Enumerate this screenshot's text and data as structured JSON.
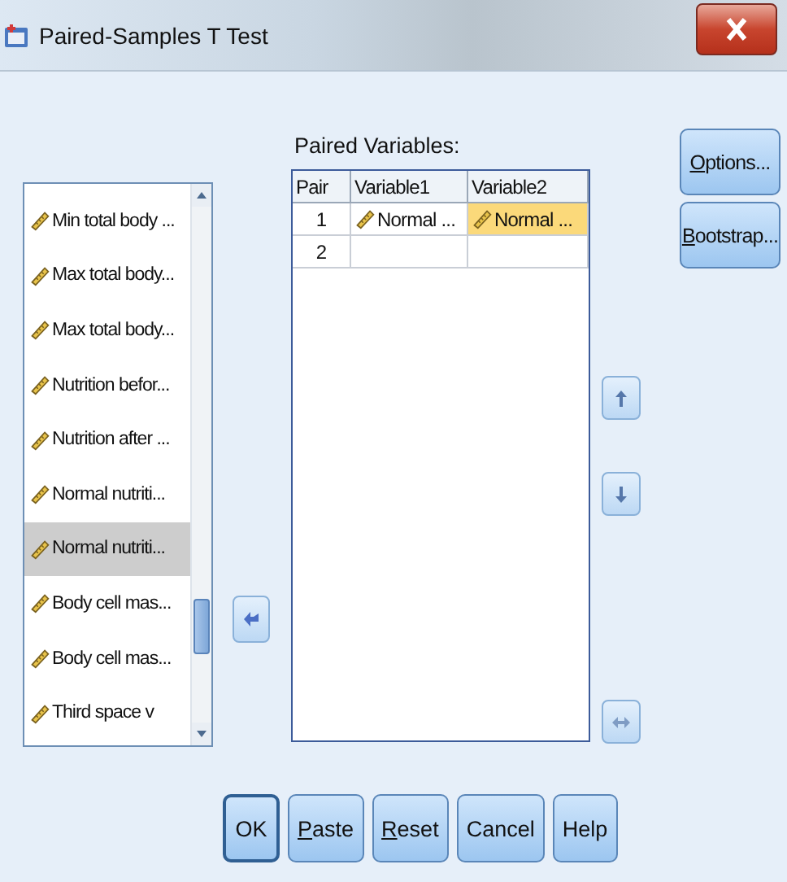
{
  "window": {
    "title": "Paired-Samples T Test"
  },
  "variables": [
    {
      "name": "Min total body ...",
      "selected": false
    },
    {
      "name": "Max total body...",
      "selected": false
    },
    {
      "name": "Max total body...",
      "selected": false
    },
    {
      "name": "Nutrition befor...",
      "selected": false
    },
    {
      "name": "Nutrition after ...",
      "selected": false
    },
    {
      "name": "Normal nutriti...",
      "selected": false
    },
    {
      "name": "Normal nutriti...",
      "selected": true
    },
    {
      "name": "Body cell mas...",
      "selected": false
    },
    {
      "name": "Body cell mas...",
      "selected": false
    },
    {
      "name": "Third space v",
      "selected": false
    }
  ],
  "paired_variables": {
    "label": "Paired Variables:",
    "columns": [
      "Pair",
      "Variable1",
      "Variable2"
    ],
    "rows": [
      {
        "pair": "1",
        "variable1": {
          "name": "Normal ...",
          "selected": false
        },
        "variable2": {
          "name": "Normal ...",
          "selected": true
        }
      },
      {
        "pair": "2"
      }
    ]
  },
  "side_buttons": [
    {
      "label": "Options...",
      "underline_first": true
    },
    {
      "label": "Bootstrap...",
      "underline_first": true
    }
  ],
  "buttons": [
    {
      "label": "OK",
      "underline_first": false,
      "default": true
    },
    {
      "label": "Paste",
      "underline_first": true,
      "default": false
    },
    {
      "label": "Reset",
      "underline_first": true,
      "default": false
    },
    {
      "label": "Cancel",
      "underline_first": false,
      "default": false
    },
    {
      "label": "Help",
      "underline_first": false,
      "default": false
    }
  ]
}
